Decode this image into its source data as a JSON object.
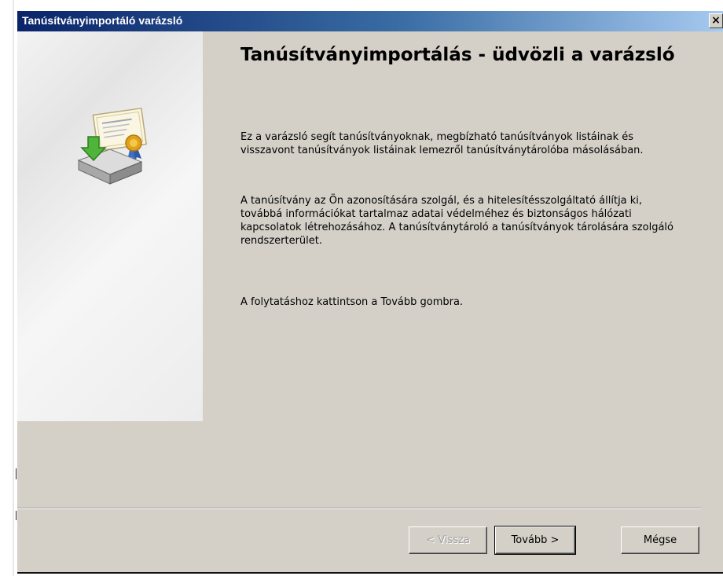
{
  "window": {
    "title": "Tanúsítványimportáló varázsló",
    "close_glyph": "×"
  },
  "side_panel": {
    "icon": "certificate-import-icon"
  },
  "content": {
    "heading": "Tanúsítványimportálás - üdvözli a varázsló",
    "paragraph1": "Ez a varázsló segít tanúsítványoknak, megbízható tanúsítványok listáinak és visszavont tanúsítványok listáinak lemezről tanúsítványtárolóba másolásában.",
    "paragraph2": "A tanúsítvány az Ön azonosítására szolgál, és a hitelesítésszolgáltató állítja ki, továbbá információkat tartalmaz adatai védelméhez és biztonságos hálózati kapcsolatok létrehozásához. A tanúsítványtároló a tanúsítványok tárolására szolgáló rendszerterület.",
    "paragraph3": "A folytatáshoz kattintson a Tovább gombra."
  },
  "buttons": {
    "back": "< Vissza",
    "next": "Tovább >",
    "cancel": "Mégse"
  },
  "colors": {
    "titlebar_start": "#0a246a",
    "titlebar_end": "#a6caf0",
    "dialog_bg": "#d4d0c8"
  }
}
